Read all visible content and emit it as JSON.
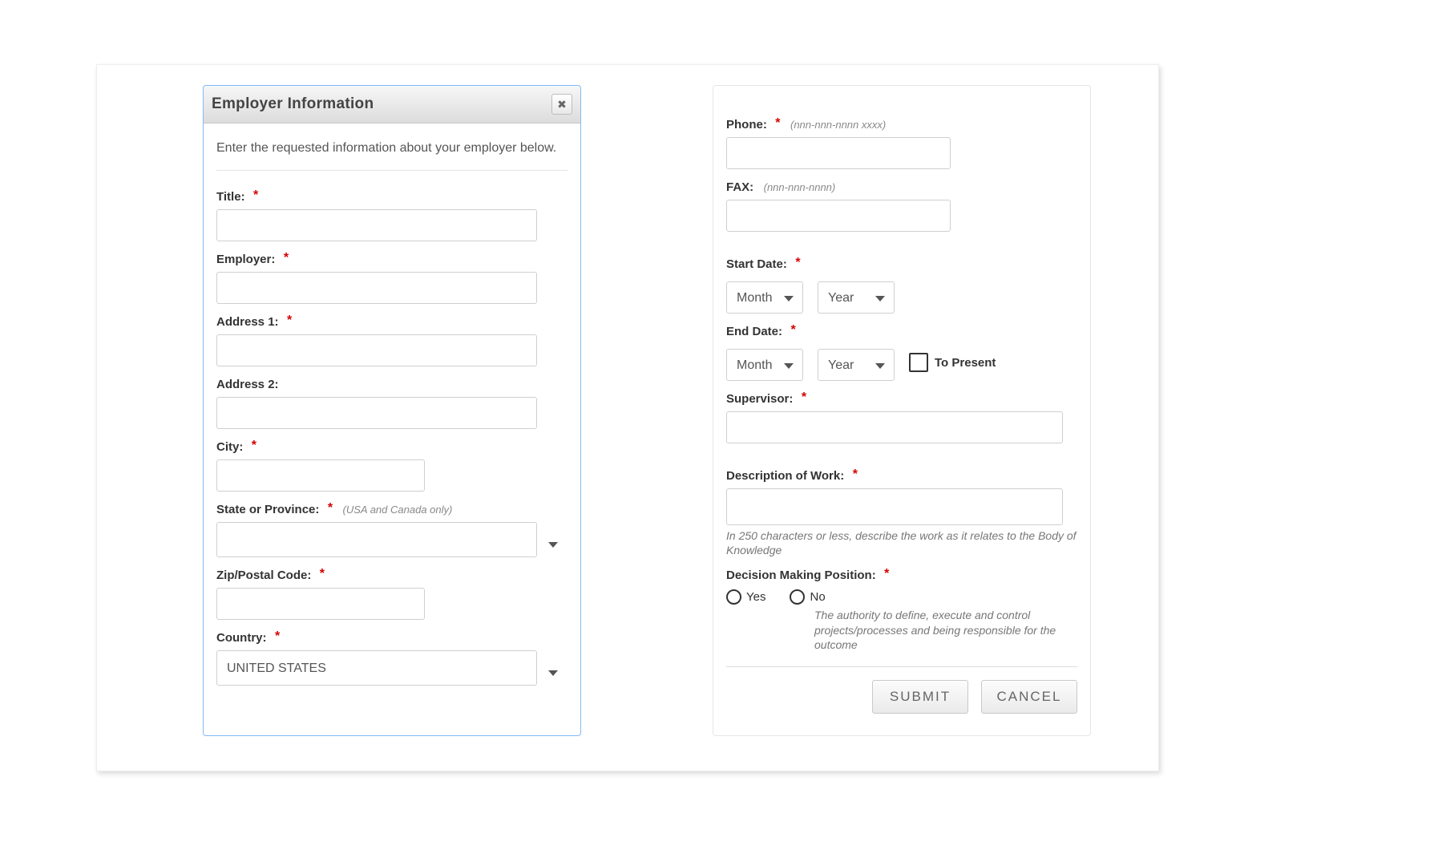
{
  "dialog": {
    "title": "Employer Information",
    "intro": "Enter the requested information about your employer below."
  },
  "left": {
    "title_label": "Title:",
    "employer_label": "Employer:",
    "addr1_label": "Address 1:",
    "addr2_label": "Address 2:",
    "city_label": "City:",
    "state_label": "State or Province:",
    "state_hint": "(USA and Canada only)",
    "zip_label": "Zip/Postal Code:",
    "country_label": "Country:",
    "country_value": "UNITED STATES"
  },
  "right": {
    "phone_label": "Phone:",
    "phone_hint": "(nnn-nnn-nnnn xxxx)",
    "fax_label": "FAX:",
    "fax_hint": "(nnn-nnn-nnnn)",
    "start_label": "Start Date:",
    "end_label": "End Date:",
    "month_opt": "Month",
    "year_opt": "Year",
    "to_present": "To Present",
    "supervisor_label": "Supervisor:",
    "desc_label": "Description of Work:",
    "desc_help": "In 250 characters or less, describe the work as it relates to the Body of Knowledge",
    "decision_label": "Decision Making Position:",
    "decision_yes": "Yes",
    "decision_no": "No",
    "decision_help": "The authority to define, execute and control projects/processes and being responsible for the outcome",
    "submit": "SUBMIT",
    "cancel": "CANCEL"
  }
}
